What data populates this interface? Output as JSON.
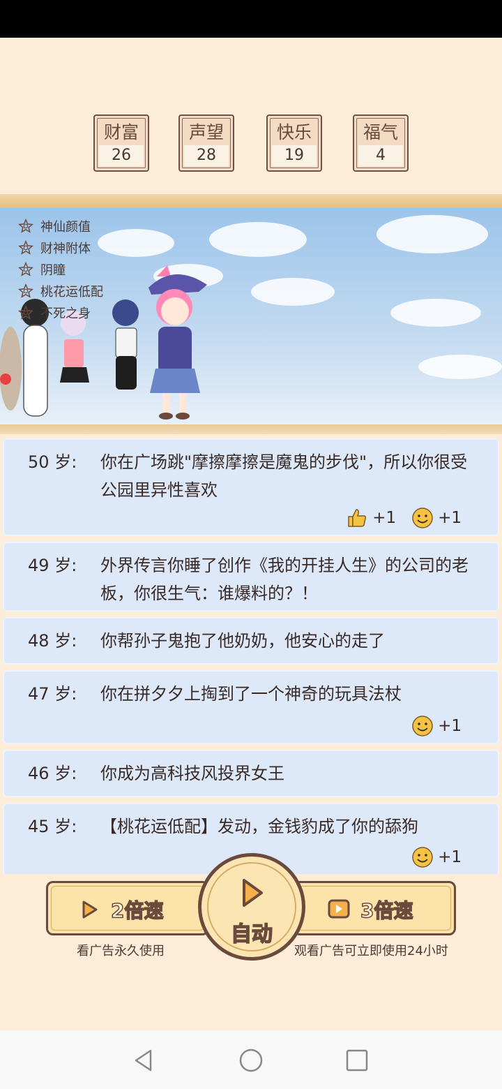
{
  "stats": [
    {
      "name": "财富",
      "value": "26"
    },
    {
      "name": "声望",
      "value": "28"
    },
    {
      "name": "快乐",
      "value": "19"
    },
    {
      "name": "福气",
      "value": "4"
    }
  ],
  "talents": [
    "神仙颜值",
    "财神附体",
    "阴瞳",
    "桃花运低配",
    "不死之身"
  ],
  "log": [
    {
      "age": "50",
      "unit": "岁",
      "text": "你在广场跳\"摩擦摩擦是魔鬼的步伐\"，所以你很受公园里异性喜欢",
      "bonuses": [
        {
          "icon": "thumbs-up-icon",
          "label": "+1"
        },
        {
          "icon": "smile-icon",
          "label": "+1"
        }
      ]
    },
    {
      "age": "49",
      "unit": "岁",
      "text": "外界传言你睡了创作《我的开挂人生》的公司的老板，你很生气：谁爆料的？！",
      "bonuses": []
    },
    {
      "age": "48",
      "unit": "岁",
      "text": "你帮孙子鬼抱了他奶奶，他安心的走了",
      "bonuses": []
    },
    {
      "age": "47",
      "unit": "岁",
      "text": "你在拼夕夕上掏到了一个神奇的玩具法杖",
      "bonuses": [
        {
          "icon": "smile-icon",
          "label": "+1"
        }
      ]
    },
    {
      "age": "46",
      "unit": "岁",
      "text": "你成为高科技风投界女王",
      "bonuses": []
    },
    {
      "age": "45",
      "unit": "岁",
      "text": "【桃花运低配】发动，金钱豹成了你的舔狗",
      "bonuses": [
        {
          "icon": "smile-icon",
          "label": "+1"
        }
      ]
    }
  ],
  "controls": {
    "speed2_label": "2倍速",
    "speed2_sub": "看广告永久使用",
    "auto_label": "自动",
    "speed3_label": "3倍速",
    "speed3_sub": "观看广告可立即使用24小时"
  },
  "colors": {
    "background": "#fcecd8",
    "card": "#dde9f9",
    "button": "#fbe3a9",
    "outline": "#6b4a3e"
  }
}
